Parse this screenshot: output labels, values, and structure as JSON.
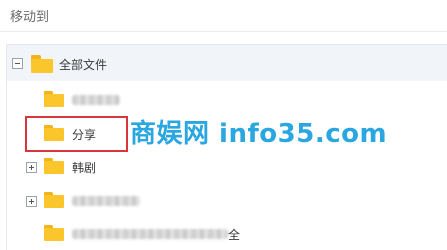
{
  "dialog": {
    "title": "移动到"
  },
  "tree": {
    "root": {
      "label": "全部文件",
      "expanded": true
    },
    "items": [
      {
        "label": "",
        "label_obscured": true,
        "expandable": false
      },
      {
        "label": "分享",
        "label_obscured": false,
        "expandable": false,
        "highlighted": true
      },
      {
        "label": "韩剧",
        "label_obscured": false,
        "expandable": true
      },
      {
        "label": "",
        "label_obscured": true,
        "expandable": true
      },
      {
        "label": "",
        "label_obscured": true,
        "trailing_text": "全",
        "expandable": false
      }
    ]
  },
  "watermark": {
    "text": "商娱网 info35.com"
  },
  "colors": {
    "folder": "#fbc52c",
    "root_row_background": "#f1f4f8",
    "highlight_border": "#d9353b",
    "watermark": "#2aa6e0"
  }
}
